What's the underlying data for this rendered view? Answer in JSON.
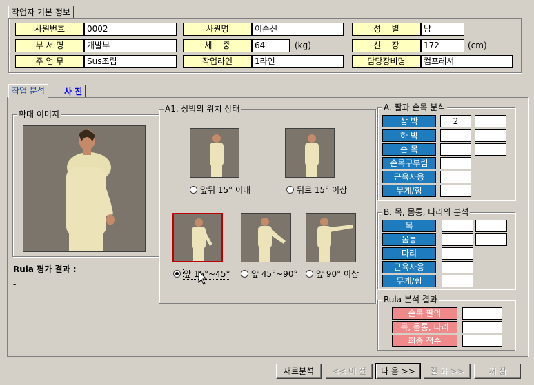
{
  "worker_info": {
    "tab_label": "작업자 기본 정보",
    "rows": [
      [
        {
          "label": "사원번호",
          "value": "0002"
        },
        {
          "label": "사원명",
          "value": "이순신"
        },
        {
          "label": "성    별",
          "value": "남"
        }
      ],
      [
        {
          "label": "부 서 명",
          "value": "개발부"
        },
        {
          "label": "체    중",
          "value": "64",
          "unit": "(kg)"
        },
        {
          "label": "신    장",
          "value": "172",
          "unit": "(cm)"
        }
      ],
      [
        {
          "label": "주 업 무",
          "value": "Sus조립"
        },
        {
          "label": "작업라인",
          "value": "1라인"
        },
        {
          "label": "담당장비명",
          "value": "컴프레셔"
        }
      ]
    ]
  },
  "tabs": [
    {
      "label": "작업 분석",
      "active": true
    },
    {
      "label": "사 진",
      "active": false
    }
  ],
  "zoom_image": {
    "title": "확대 이미지"
  },
  "rula_eval": {
    "label": "Rula 평가 결과 :",
    "value": "-"
  },
  "upper_arm": {
    "title": "A1. 상박의 위치 상태",
    "options": [
      {
        "label": "앞뒤 15° 이내",
        "selected": false
      },
      {
        "label": "뒤로 15° 이상",
        "selected": false
      },
      {
        "label": "앞 15°~45°",
        "selected": true
      },
      {
        "label": "앞 45°~90°",
        "selected": false
      },
      {
        "label": "앞 90° 이상",
        "selected": false
      }
    ]
  },
  "arm_wrist": {
    "title": "A. 팔과 손목 분석",
    "rows": [
      {
        "label": "상 박",
        "v1": "2",
        "v2": ""
      },
      {
        "label": "하 박",
        "v1": "",
        "v2": ""
      },
      {
        "label": "손 목",
        "v1": "",
        "v2": ""
      },
      {
        "label": "손목구부림",
        "v1": ""
      },
      {
        "label": "근육사용",
        "v1": ""
      },
      {
        "label": "무게/힘",
        "v1": ""
      }
    ]
  },
  "neck_trunk_leg": {
    "title": "B. 목, 몸통, 다리의 분석",
    "rows": [
      {
        "label": "목",
        "v1": "",
        "v2": ""
      },
      {
        "label": "몸통",
        "v1": "",
        "v2": ""
      },
      {
        "label": "다리",
        "v1": ""
      },
      {
        "label": "근육사용",
        "v1": ""
      },
      {
        "label": "무게/힘",
        "v1": ""
      }
    ]
  },
  "rula_result": {
    "title": "Rula 분석 결과",
    "rows": [
      {
        "label": "손목 팔의",
        "value": ""
      },
      {
        "label": "목, 몸통, 다리",
        "value": ""
      },
      {
        "label": "최종 점수",
        "value": ""
      }
    ]
  },
  "buttons": {
    "new": "새로분석",
    "prev": "<< 이 전",
    "next": "다 음 >>",
    "result": "결 과 >>",
    "save": "저 장"
  },
  "colors": {
    "label_bg": "#ffffc0",
    "section_label": "#1e7bbd",
    "result_label": "#f08a8a",
    "selected_border": "#c00000"
  }
}
